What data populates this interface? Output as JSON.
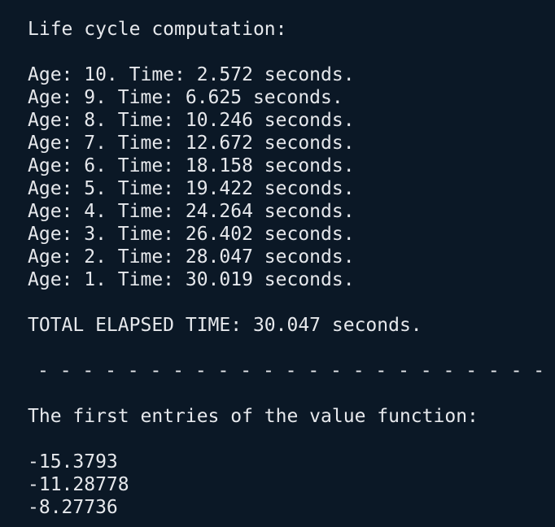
{
  "terminal": {
    "header": "Life cycle computation:",
    "age_lines": [
      "Age: 10. Time: 2.572 seconds.",
      "Age: 9. Time: 6.625 seconds.",
      "Age: 8. Time: 10.246 seconds.",
      "Age: 7. Time: 12.672 seconds.",
      "Age: 6. Time: 18.158 seconds.",
      "Age: 5. Time: 19.422 seconds.",
      "Age: 4. Time: 24.264 seconds.",
      "Age: 3. Time: 26.402 seconds.",
      "Age: 2. Time: 28.047 seconds.",
      "Age: 1. Time: 30.019 seconds."
    ],
    "total_line": "TOTAL ELAPSED TIME: 30.047 seconds.",
    "separator": "- - - - - - - - - - - - - - - - - - - - - - - -",
    "value_header": "The first entries of the value function:",
    "values": [
      "-15.3793",
      "-11.28778",
      "-8.27736"
    ]
  }
}
